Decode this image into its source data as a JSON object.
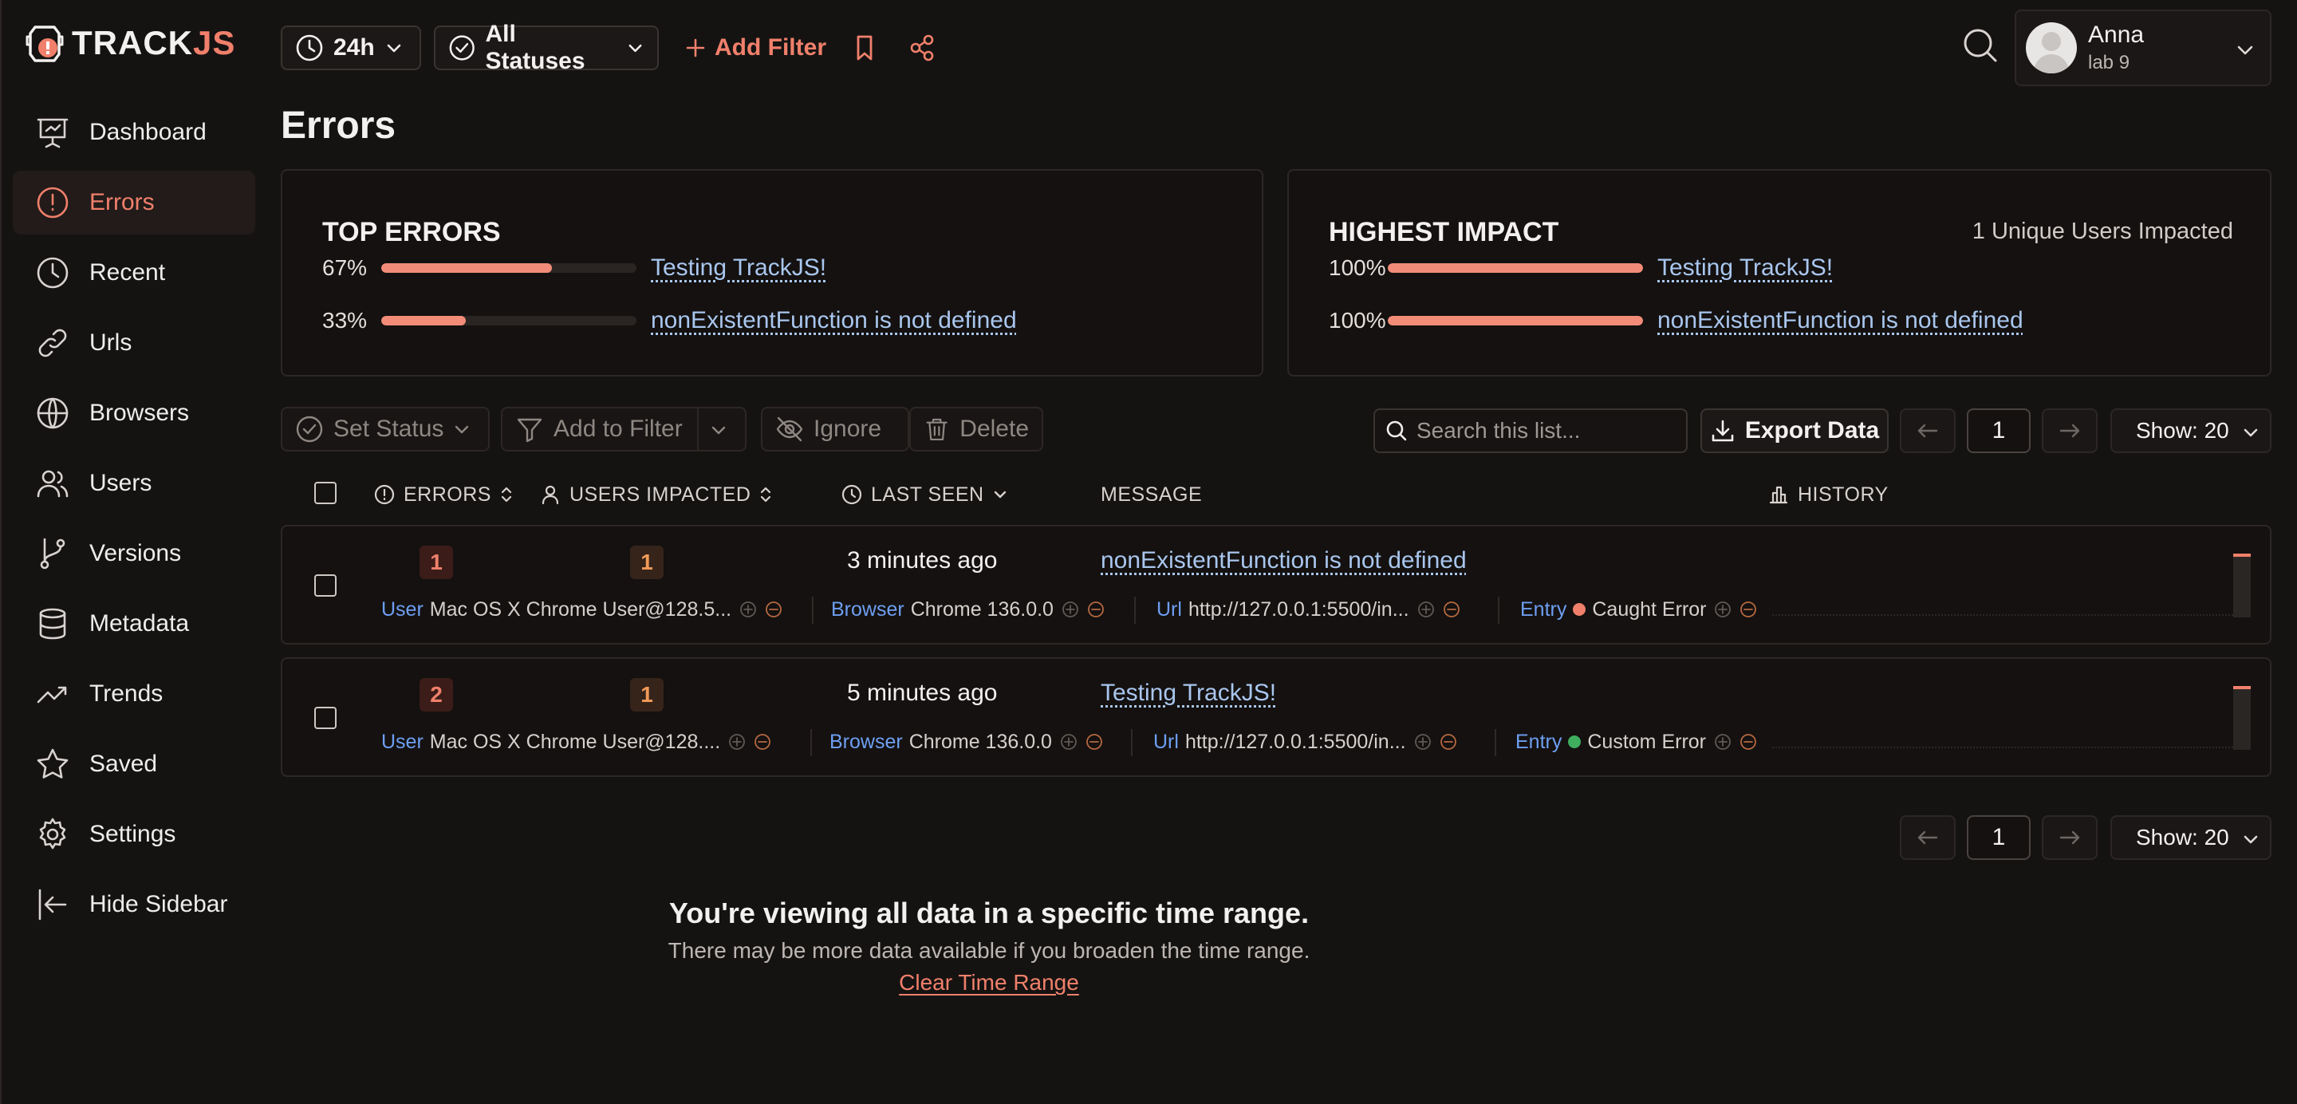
{
  "app": {
    "logo_text_main": "TRACK",
    "logo_text_accent": "JS",
    "brand_color": "#f0806b"
  },
  "sidebar": {
    "items": [
      {
        "label": "Dashboard",
        "icon": "presentation-icon",
        "active": false
      },
      {
        "label": "Errors",
        "icon": "alert-circle-icon",
        "active": true
      },
      {
        "label": "Recent",
        "icon": "clock-icon",
        "active": false
      },
      {
        "label": "Urls",
        "icon": "link-icon",
        "active": false
      },
      {
        "label": "Browsers",
        "icon": "globe-icon",
        "active": false
      },
      {
        "label": "Users",
        "icon": "users-icon",
        "active": false
      },
      {
        "label": "Versions",
        "icon": "git-branch-icon",
        "active": false
      },
      {
        "label": "Metadata",
        "icon": "database-icon",
        "active": false
      },
      {
        "label": "Trends",
        "icon": "trending-up-icon",
        "active": false
      },
      {
        "label": "Saved",
        "icon": "star-icon",
        "active": false
      },
      {
        "label": "Settings",
        "icon": "gear-icon",
        "active": false
      },
      {
        "label": "Hide Sidebar",
        "icon": "collapse-left-icon",
        "active": false
      }
    ]
  },
  "topbar": {
    "time_range": "24h",
    "status_filter": "All Statuses",
    "add_filter": "Add Filter",
    "user": {
      "name": "Anna",
      "org": "lab 9"
    }
  },
  "page": {
    "title": "Errors"
  },
  "top_errors": {
    "title": "TOP ERRORS",
    "rows": [
      {
        "pct_label": "67%",
        "pct": 0.67,
        "message": "Testing TrackJS!"
      },
      {
        "pct_label": "33%",
        "pct": 0.33,
        "message": "nonExistentFunction is not defined"
      }
    ]
  },
  "highest_impact": {
    "title": "HIGHEST IMPACT",
    "aside": "1 Unique Users Impacted",
    "rows": [
      {
        "pct_label": "100%",
        "pct": 1.0,
        "message": "Testing TrackJS!"
      },
      {
        "pct_label": "100%",
        "pct": 1.0,
        "message": "nonExistentFunction is not defined"
      }
    ]
  },
  "toolbar": {
    "set_status": "Set Status",
    "add_to_filter": "Add to Filter",
    "ignore": "Ignore",
    "delete": "Delete",
    "search_placeholder": "Search this list...",
    "export": "Export Data",
    "page": "1",
    "show": "Show: 20"
  },
  "table": {
    "columns": {
      "errors": "ERRORS",
      "users": "USERS IMPACTED",
      "last_seen": "LAST SEEN",
      "message": "MESSAGE",
      "history": "HISTORY"
    },
    "rows": [
      {
        "errors": "1",
        "users": "1",
        "last_seen": "3 minutes ago",
        "message": "nonExistentFunction is not defined",
        "user_key": "User",
        "user_val": "Mac OS X Chrome User@128.5...",
        "browser_key": "Browser",
        "browser_val": "Chrome 136.0.0",
        "url_key": "Url",
        "url_val": "http://127.0.0.1:5500/in...",
        "entry_key": "Entry",
        "entry_val": "Caught Error",
        "entry_color": "#f0806b"
      },
      {
        "errors": "2",
        "users": "1",
        "last_seen": "5 minutes ago",
        "message": "Testing TrackJS!",
        "user_key": "User",
        "user_val": "Mac OS X Chrome User@128....",
        "browser_key": "Browser",
        "browser_val": "Chrome 136.0.0",
        "url_key": "Url",
        "url_val": "http://127.0.0.1:5500/in...",
        "entry_key": "Entry",
        "entry_val": "Custom Error",
        "entry_color": "#3fae5f"
      }
    ]
  },
  "footer": {
    "title": "You're viewing all data in a specific time range.",
    "subtitle": "There may be more data available if you broaden the time range.",
    "link": "Clear Time Range"
  }
}
